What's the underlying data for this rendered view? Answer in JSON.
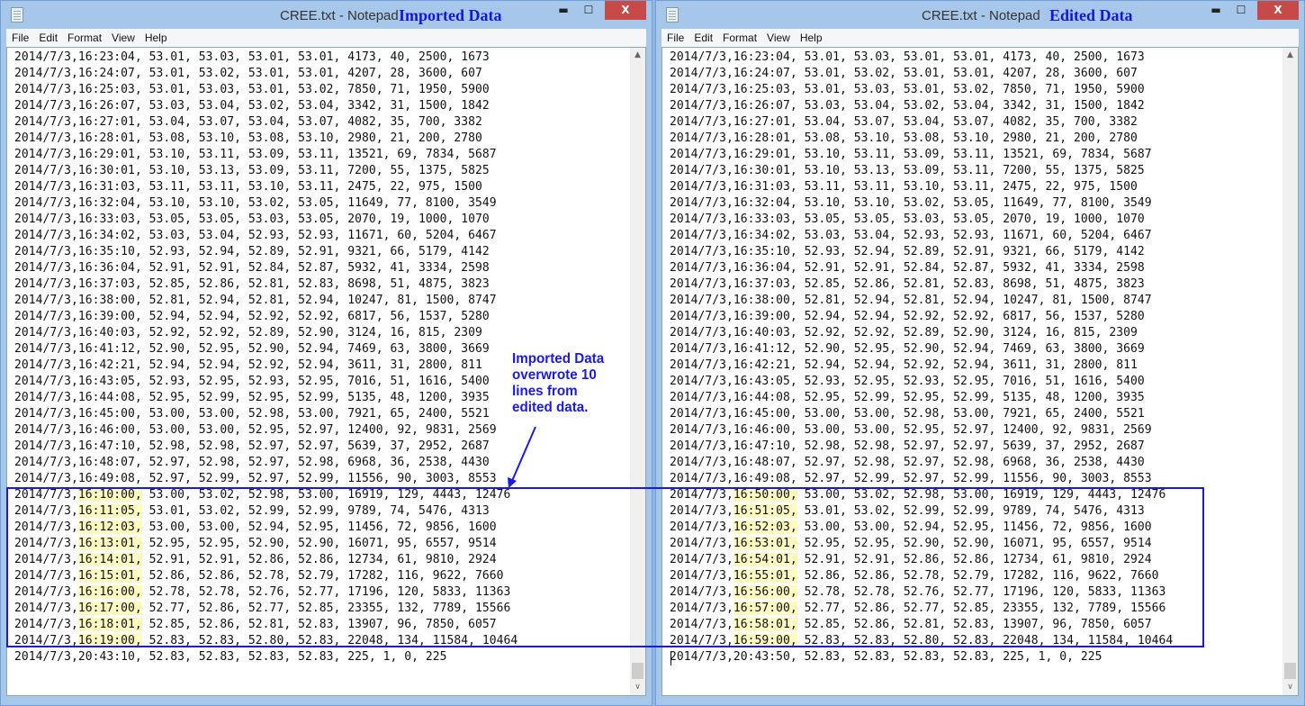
{
  "windows": [
    {
      "id": "left",
      "title": "CREE.txt - Notepad",
      "tag": "Imported Data",
      "menu": [
        "File",
        "Edit",
        "Format",
        "View",
        "Help"
      ],
      "rows": [
        {
          "date": "2014/7/3,",
          "time": "16:23:04,",
          "rest": " 53.01, 53.03, 53.01, 53.01, 4173, 40, 2500, 1673"
        },
        {
          "date": "2014/7/3,",
          "time": "16:24:07,",
          "rest": " 53.01, 53.02, 53.01, 53.01, 4207, 28, 3600, 607"
        },
        {
          "date": "2014/7/3,",
          "time": "16:25:03,",
          "rest": " 53.01, 53.03, 53.01, 53.02, 7850, 71, 1950, 5900"
        },
        {
          "date": "2014/7/3,",
          "time": "16:26:07,",
          "rest": " 53.03, 53.04, 53.02, 53.04, 3342, 31, 1500, 1842"
        },
        {
          "date": "2014/7/3,",
          "time": "16:27:01,",
          "rest": " 53.04, 53.07, 53.04, 53.07, 4082, 35, 700, 3382"
        },
        {
          "date": "2014/7/3,",
          "time": "16:28:01,",
          "rest": " 53.08, 53.10, 53.08, 53.10, 2980, 21, 200, 2780"
        },
        {
          "date": "2014/7/3,",
          "time": "16:29:01,",
          "rest": " 53.10, 53.11, 53.09, 53.11, 13521, 69, 7834, 5687"
        },
        {
          "date": "2014/7/3,",
          "time": "16:30:01,",
          "rest": " 53.10, 53.13, 53.09, 53.11, 7200, 55, 1375, 5825"
        },
        {
          "date": "2014/7/3,",
          "time": "16:31:03,",
          "rest": " 53.11, 53.11, 53.10, 53.11, 2475, 22, 975, 1500"
        },
        {
          "date": "2014/7/3,",
          "time": "16:32:04,",
          "rest": " 53.10, 53.10, 53.02, 53.05, 11649, 77, 8100, 3549"
        },
        {
          "date": "2014/7/3,",
          "time": "16:33:03,",
          "rest": " 53.05, 53.05, 53.03, 53.05, 2070, 19, 1000, 1070"
        },
        {
          "date": "2014/7/3,",
          "time": "16:34:02,",
          "rest": " 53.03, 53.04, 52.93, 52.93, 11671, 60, 5204, 6467"
        },
        {
          "date": "2014/7/3,",
          "time": "16:35:10,",
          "rest": " 52.93, 52.94, 52.89, 52.91, 9321, 66, 5179, 4142"
        },
        {
          "date": "2014/7/3,",
          "time": "16:36:04,",
          "rest": " 52.91, 52.91, 52.84, 52.87, 5932, 41, 3334, 2598"
        },
        {
          "date": "2014/7/3,",
          "time": "16:37:03,",
          "rest": " 52.85, 52.86, 52.81, 52.83, 8698, 51, 4875, 3823"
        },
        {
          "date": "2014/7/3,",
          "time": "16:38:00,",
          "rest": " 52.81, 52.94, 52.81, 52.94, 10247, 81, 1500, 8747"
        },
        {
          "date": "2014/7/3,",
          "time": "16:39:00,",
          "rest": " 52.94, 52.94, 52.92, 52.92, 6817, 56, 1537, 5280"
        },
        {
          "date": "2014/7/3,",
          "time": "16:40:03,",
          "rest": " 52.92, 52.92, 52.89, 52.90, 3124, 16, 815, 2309"
        },
        {
          "date": "2014/7/3,",
          "time": "16:41:12,",
          "rest": " 52.90, 52.95, 52.90, 52.94, 7469, 63, 3800, 3669"
        },
        {
          "date": "2014/7/3,",
          "time": "16:42:21,",
          "rest": " 52.94, 52.94, 52.92, 52.94, 3611, 31, 2800, 811"
        },
        {
          "date": "2014/7/3,",
          "time": "16:43:05,",
          "rest": " 52.93, 52.95, 52.93, 52.95, 7016, 51, 1616, 5400"
        },
        {
          "date": "2014/7/3,",
          "time": "16:44:08,",
          "rest": " 52.95, 52.99, 52.95, 52.99, 5135, 48, 1200, 3935"
        },
        {
          "date": "2014/7/3,",
          "time": "16:45:00,",
          "rest": " 53.00, 53.00, 52.98, 53.00, 7921, 65, 2400, 5521"
        },
        {
          "date": "2014/7/3,",
          "time": "16:46:00,",
          "rest": " 53.00, 53.00, 52.95, 52.97, 12400, 92, 9831, 2569"
        },
        {
          "date": "2014/7/3,",
          "time": "16:47:10,",
          "rest": " 52.98, 52.98, 52.97, 52.97, 5639, 37, 2952, 2687"
        },
        {
          "date": "2014/7/3,",
          "time": "16:48:07,",
          "rest": " 52.97, 52.98, 52.97, 52.98, 6968, 36, 2538, 4430"
        },
        {
          "date": "2014/7/3,",
          "time": "16:49:08,",
          "rest": " 52.97, 52.99, 52.97, 52.99, 11556, 90, 3003, 8553"
        },
        {
          "date": "2014/7/3,",
          "time": "16:10:00,",
          "rest": " 53.00, 53.02, 52.98, 53.00, 16919, 129, 4443, 12476",
          "highlight": true
        },
        {
          "date": "2014/7/3,",
          "time": "16:11:05,",
          "rest": " 53.01, 53.02, 52.99, 52.99, 9789, 74, 5476, 4313",
          "highlight": true
        },
        {
          "date": "2014/7/3,",
          "time": "16:12:03,",
          "rest": " 53.00, 53.00, 52.94, 52.95, 11456, 72, 9856, 1600",
          "highlight": true
        },
        {
          "date": "2014/7/3,",
          "time": "16:13:01,",
          "rest": " 52.95, 52.95, 52.90, 52.90, 16071, 95, 6557, 9514",
          "highlight": true
        },
        {
          "date": "2014/7/3,",
          "time": "16:14:01,",
          "rest": " 52.91, 52.91, 52.86, 52.86, 12734, 61, 9810, 2924",
          "highlight": true
        },
        {
          "date": "2014/7/3,",
          "time": "16:15:01,",
          "rest": " 52.86, 52.86, 52.78, 52.79, 17282, 116, 9622, 7660",
          "highlight": true
        },
        {
          "date": "2014/7/3,",
          "time": "16:16:00,",
          "rest": " 52.78, 52.78, 52.76, 52.77, 17196, 120, 5833, 11363",
          "highlight": true
        },
        {
          "date": "2014/7/3,",
          "time": "16:17:00,",
          "rest": " 52.77, 52.86, 52.77, 52.85, 23355, 132, 7789, 15566",
          "highlight": true
        },
        {
          "date": "2014/7/3,",
          "time": "16:18:01,",
          "rest": " 52.85, 52.86, 52.81, 52.83, 13907, 96, 7850, 6057",
          "highlight": true
        },
        {
          "date": "2014/7/3,",
          "time": "16:19:00,",
          "rest": " 52.83, 52.83, 52.80, 52.83, 22048, 134, 11584, 10464",
          "highlight": true
        },
        {
          "date": "2014/7/3,",
          "time": "20:43:10,",
          "rest": " 52.83, 52.83, 52.83, 52.83, 225, 1, 0, 225"
        }
      ]
    },
    {
      "id": "right",
      "title": "CREE.txt - Notepad",
      "tag": "Edited Data",
      "menu": [
        "File",
        "Edit",
        "Format",
        "View",
        "Help"
      ],
      "rows": [
        {
          "date": "2014/7/3,",
          "time": "16:23:04,",
          "rest": " 53.01, 53.03, 53.01, 53.01, 4173, 40, 2500, 1673"
        },
        {
          "date": "2014/7/3,",
          "time": "16:24:07,",
          "rest": " 53.01, 53.02, 53.01, 53.01, 4207, 28, 3600, 607"
        },
        {
          "date": "2014/7/3,",
          "time": "16:25:03,",
          "rest": " 53.01, 53.03, 53.01, 53.02, 7850, 71, 1950, 5900"
        },
        {
          "date": "2014/7/3,",
          "time": "16:26:07,",
          "rest": " 53.03, 53.04, 53.02, 53.04, 3342, 31, 1500, 1842"
        },
        {
          "date": "2014/7/3,",
          "time": "16:27:01,",
          "rest": " 53.04, 53.07, 53.04, 53.07, 4082, 35, 700, 3382"
        },
        {
          "date": "2014/7/3,",
          "time": "16:28:01,",
          "rest": " 53.08, 53.10, 53.08, 53.10, 2980, 21, 200, 2780"
        },
        {
          "date": "2014/7/3,",
          "time": "16:29:01,",
          "rest": " 53.10, 53.11, 53.09, 53.11, 13521, 69, 7834, 5687"
        },
        {
          "date": "2014/7/3,",
          "time": "16:30:01,",
          "rest": " 53.10, 53.13, 53.09, 53.11, 7200, 55, 1375, 5825"
        },
        {
          "date": "2014/7/3,",
          "time": "16:31:03,",
          "rest": " 53.11, 53.11, 53.10, 53.11, 2475, 22, 975, 1500"
        },
        {
          "date": "2014/7/3,",
          "time": "16:32:04,",
          "rest": " 53.10, 53.10, 53.02, 53.05, 11649, 77, 8100, 3549"
        },
        {
          "date": "2014/7/3,",
          "time": "16:33:03,",
          "rest": " 53.05, 53.05, 53.03, 53.05, 2070, 19, 1000, 1070"
        },
        {
          "date": "2014/7/3,",
          "time": "16:34:02,",
          "rest": " 53.03, 53.04, 52.93, 52.93, 11671, 60, 5204, 6467"
        },
        {
          "date": "2014/7/3,",
          "time": "16:35:10,",
          "rest": " 52.93, 52.94, 52.89, 52.91, 9321, 66, 5179, 4142"
        },
        {
          "date": "2014/7/3,",
          "time": "16:36:04,",
          "rest": " 52.91, 52.91, 52.84, 52.87, 5932, 41, 3334, 2598"
        },
        {
          "date": "2014/7/3,",
          "time": "16:37:03,",
          "rest": " 52.85, 52.86, 52.81, 52.83, 8698, 51, 4875, 3823"
        },
        {
          "date": "2014/7/3,",
          "time": "16:38:00,",
          "rest": " 52.81, 52.94, 52.81, 52.94, 10247, 81, 1500, 8747"
        },
        {
          "date": "2014/7/3,",
          "time": "16:39:00,",
          "rest": " 52.94, 52.94, 52.92, 52.92, 6817, 56, 1537, 5280"
        },
        {
          "date": "2014/7/3,",
          "time": "16:40:03,",
          "rest": " 52.92, 52.92, 52.89, 52.90, 3124, 16, 815, 2309"
        },
        {
          "date": "2014/7/3,",
          "time": "16:41:12,",
          "rest": " 52.90, 52.95, 52.90, 52.94, 7469, 63, 3800, 3669"
        },
        {
          "date": "2014/7/3,",
          "time": "16:42:21,",
          "rest": " 52.94, 52.94, 52.92, 52.94, 3611, 31, 2800, 811"
        },
        {
          "date": "2014/7/3,",
          "time": "16:43:05,",
          "rest": " 52.93, 52.95, 52.93, 52.95, 7016, 51, 1616, 5400"
        },
        {
          "date": "2014/7/3,",
          "time": "16:44:08,",
          "rest": " 52.95, 52.99, 52.95, 52.99, 5135, 48, 1200, 3935"
        },
        {
          "date": "2014/7/3,",
          "time": "16:45:00,",
          "rest": " 53.00, 53.00, 52.98, 53.00, 7921, 65, 2400, 5521"
        },
        {
          "date": "2014/7/3,",
          "time": "16:46:00,",
          "rest": " 53.00, 53.00, 52.95, 52.97, 12400, 92, 9831, 2569"
        },
        {
          "date": "2014/7/3,",
          "time": "16:47:10,",
          "rest": " 52.98, 52.98, 52.97, 52.97, 5639, 37, 2952, 2687"
        },
        {
          "date": "2014/7/3,",
          "time": "16:48:07,",
          "rest": " 52.97, 52.98, 52.97, 52.98, 6968, 36, 2538, 4430"
        },
        {
          "date": "2014/7/3,",
          "time": "16:49:08,",
          "rest": " 52.97, 52.99, 52.97, 52.99, 11556, 90, 3003, 8553"
        },
        {
          "date": "2014/7/3,",
          "time": "16:50:00,",
          "rest": " 53.00, 53.02, 52.98, 53.00, 16919, 129, 4443, 12476",
          "highlight": true
        },
        {
          "date": "2014/7/3,",
          "time": "16:51:05,",
          "rest": " 53.01, 53.02, 52.99, 52.99, 9789, 74, 5476, 4313",
          "highlight": true
        },
        {
          "date": "2014/7/3,",
          "time": "16:52:03,",
          "rest": " 53.00, 53.00, 52.94, 52.95, 11456, 72, 9856, 1600",
          "highlight": true
        },
        {
          "date": "2014/7/3,",
          "time": "16:53:01,",
          "rest": " 52.95, 52.95, 52.90, 52.90, 16071, 95, 6557, 9514",
          "highlight": true
        },
        {
          "date": "2014/7/3,",
          "time": "16:54:01,",
          "rest": " 52.91, 52.91, 52.86, 52.86, 12734, 61, 9810, 2924",
          "highlight": true
        },
        {
          "date": "2014/7/3,",
          "time": "16:55:01,",
          "rest": " 52.86, 52.86, 52.78, 52.79, 17282, 116, 9622, 7660",
          "highlight": true
        },
        {
          "date": "2014/7/3,",
          "time": "16:56:00,",
          "rest": " 52.78, 52.78, 52.76, 52.77, 17196, 120, 5833, 11363",
          "highlight": true
        },
        {
          "date": "2014/7/3,",
          "time": "16:57:00,",
          "rest": " 52.77, 52.86, 52.77, 52.85, 23355, 132, 7789, 15566",
          "highlight": true
        },
        {
          "date": "2014/7/3,",
          "time": "16:58:01,",
          "rest": " 52.85, 52.86, 52.81, 52.83, 13907, 96, 7850, 6057",
          "highlight": true
        },
        {
          "date": "2014/7/3,",
          "time": "16:59:00,",
          "rest": " 52.83, 52.83, 52.80, 52.83, 22048, 134, 11584, 10464",
          "highlight": true
        },
        {
          "date": "2014/7/3,",
          "time": "20:43:50,",
          "rest": " 52.83, 52.83, 52.83, 52.83, 225, 1, 0, 225"
        }
      ]
    }
  ],
  "annotation": {
    "lines": [
      "Imported Data",
      "overwrote 10",
      "lines from",
      "edited data."
    ],
    "color": "#1a1ae6"
  },
  "controls": {
    "minimize": "▬",
    "maximize": "☐",
    "close": "X"
  },
  "scroll": {
    "up": "▲",
    "down": "∨"
  },
  "colors": {
    "highlight": "#fdfbc0",
    "frame": "#a7c7ea",
    "close": "#c74a48"
  }
}
